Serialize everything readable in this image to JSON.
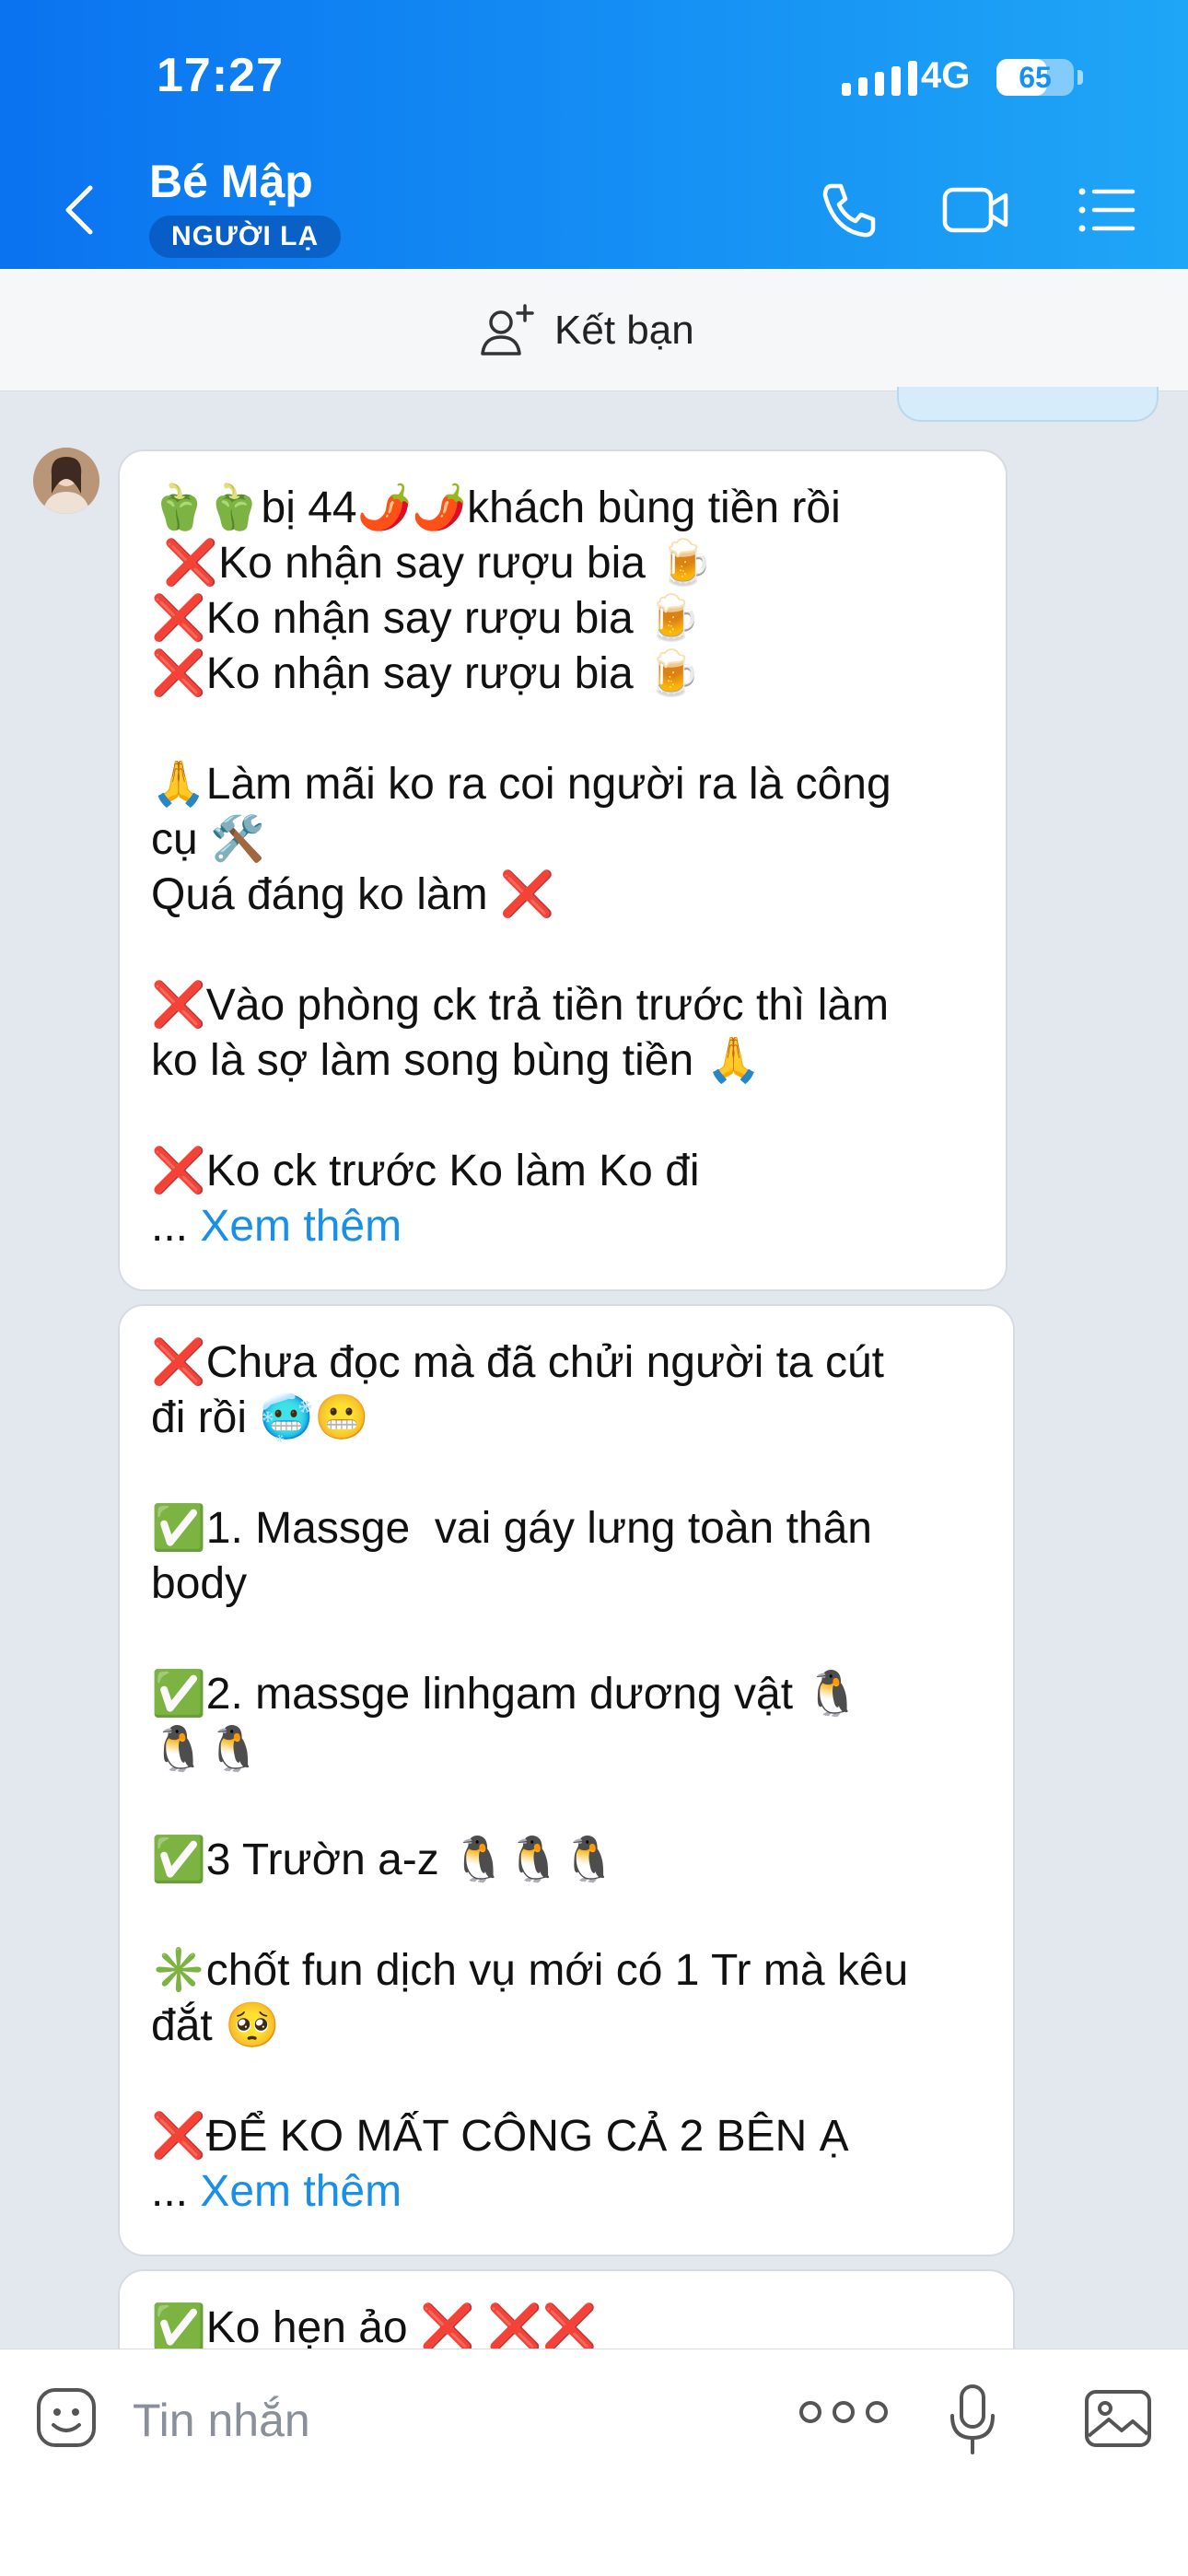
{
  "status": {
    "time": "17:27",
    "network": "4G",
    "battery": "65",
    "battery_level": 0.65
  },
  "header": {
    "contact_name": "Bé Mập",
    "contact_badge": "NGƯỜI LẠ",
    "icons": [
      "back-icon",
      "phone-icon",
      "video-call-icon",
      "list-menu-icon"
    ]
  },
  "friend_bar": {
    "label": "Kết bạn",
    "icon": "add-friend-icon"
  },
  "messages": [
    {
      "lines": [
        "🫑🫑bị 44🌶️🌶️khách bùng tiền rồi",
        " ❌Ko nhận say rượu bia 🍺",
        "❌Ko nhận say rượu bia 🍺",
        "❌Ko nhận say rượu bia 🍺",
        "",
        "🙏Làm mãi ko ra coi người ra là công",
        "cụ 🛠️",
        "Quá đáng ko làm ❌",
        "",
        "❌Vào phòng ck trả tiền trước thì làm",
        "ko là sợ làm song bùng tiền 🙏",
        "",
        "❌Ko ck trước Ko làm Ko đi"
      ],
      "more_prefix": "... ",
      "more_label": "Xem thêm"
    },
    {
      "lines": [
        "❌Chưa đọc mà đã chửi người ta cút",
        "đi rồi 🥶😬",
        "",
        "✅1. Massge  vai gáy lưng toàn thân",
        "body",
        "",
        "✅2. massge linhgam dương vật 🐧",
        "🐧🐧",
        "",
        "✅3 Trườn a-z 🐧🐧🐧",
        "",
        "✳️chốt fun dịch vụ mới có 1 Tr mà kêu",
        "đắt 🥺",
        "",
        "❌ĐỂ KO MẤT CÔNG CẢ 2 BÊN Ạ"
      ],
      "more_prefix": "... ",
      "more_label": "Xem thêm"
    },
    {
      "lines": [
        "✅Ko hẹn ảo ❌ ❌❌"
      ]
    }
  ],
  "composer": {
    "placeholder": "Tin nhắn",
    "icons": [
      "sticker-icon",
      "more-options-icon",
      "microphone-icon",
      "image-icon"
    ]
  },
  "colors": {
    "header_start": "#0a73f0",
    "header_end": "#1fa6f6",
    "link": "#1a8fe8",
    "chat_bg": "#e3e8ef"
  }
}
